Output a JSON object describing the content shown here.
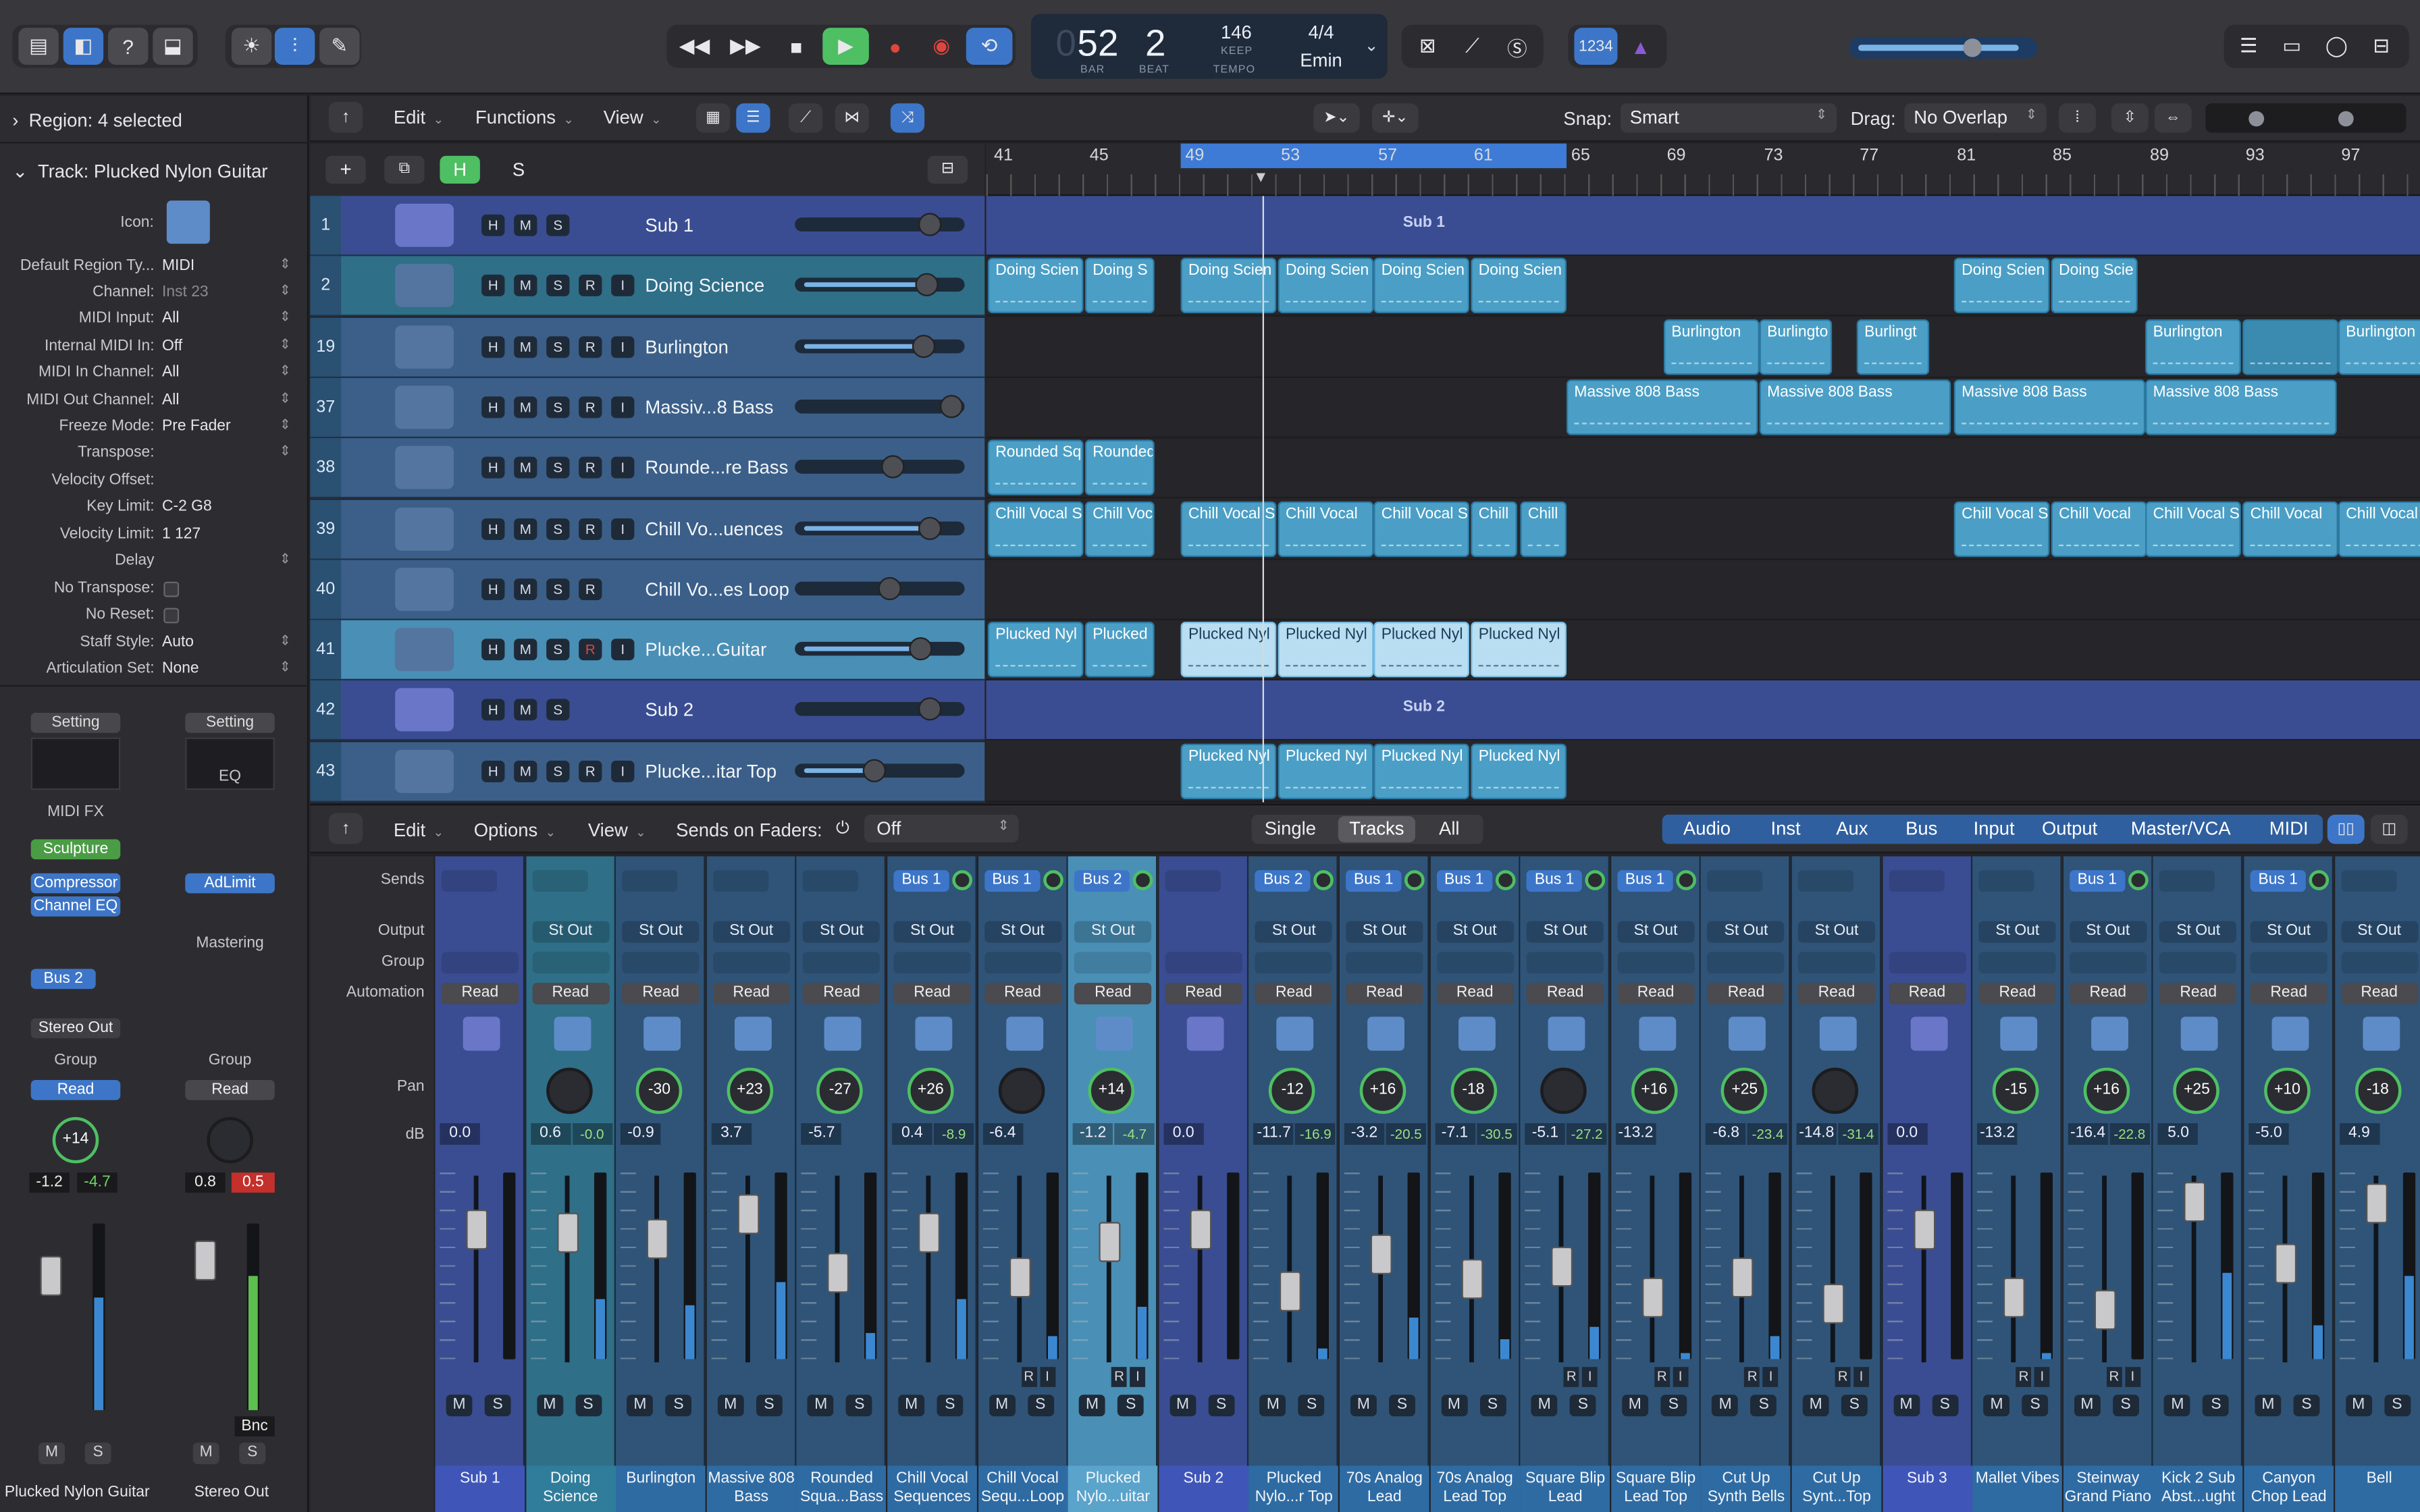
{
  "control_bar": {
    "lcd": {
      "bar": "52",
      "beat": "2",
      "bar_label": "BAR",
      "beat_label": "BEAT",
      "tempo": "146",
      "tempo_keep": "KEEP",
      "tempo_label": "TEMPO",
      "signature": "4/4",
      "key": "Emin"
    },
    "count_in": "1234",
    "icons": [
      "library-icon",
      "inspector-icon",
      "quick-help-icon",
      "toolbar-icon",
      "tuner-icon",
      "mixer-settings-icon",
      "pencil-icon",
      "rewind-icon",
      "fast-forward-icon",
      "stop-icon",
      "play-icon",
      "record-icon",
      "replace-icon",
      "cycle-icon",
      "lcd-menu-icon",
      "mute-icon",
      "tuning-icon",
      "solo-icon",
      "metronome-icon",
      "list-editors-icon",
      "note-pad-icon",
      "loop-browser-icon",
      "browsers-icon"
    ]
  },
  "inspector": {
    "region_header": "Region: 4 selected",
    "track_header": "Track: Plucked Nylon Guitar",
    "icon_label": "Icon:",
    "rows": [
      {
        "label": "Default Region Ty...",
        "value": "MIDI",
        "stepper": true
      },
      {
        "label": "Channel:",
        "value": "Inst 23",
        "stepper": true,
        "dim": true
      },
      {
        "label": "MIDI Input:",
        "value": "All",
        "stepper": true
      },
      {
        "label": "Internal MIDI In:",
        "value": "Off",
        "stepper": true
      },
      {
        "label": "MIDI In Channel:",
        "value": "All",
        "stepper": true
      },
      {
        "label": "MIDI Out Channel:",
        "value": "All",
        "stepper": true
      },
      {
        "label": "Freeze Mode:",
        "value": "Pre Fader",
        "stepper": true
      },
      {
        "label": "Transpose:",
        "value": "",
        "stepper": true
      },
      {
        "label": "Velocity Offset:",
        "value": "",
        "stepper": false
      },
      {
        "label": "Key Limit:",
        "value": "C-2  G8",
        "stepper": false
      },
      {
        "label": "Velocity Limit:",
        "value": "1  127",
        "stepper": false
      },
      {
        "label": "Delay",
        "value": "",
        "stepper": true
      },
      {
        "label": "No Transpose:",
        "value": "",
        "checkbox": true
      },
      {
        "label": "No Reset:",
        "value": "",
        "checkbox": true
      },
      {
        "label": "Staff Style:",
        "value": "Auto",
        "stepper": true
      },
      {
        "label": "Articulation Set:",
        "value": "None",
        "stepper": true
      }
    ],
    "strip_left": {
      "setting": "Setting",
      "midi_fx": "MIDI FX",
      "plugin1": "Sculpture",
      "plugin2": "Compressor",
      "plugin3": "Channel EQ",
      "send": "Bus 2",
      "output": "Stereo Out",
      "group": "Group",
      "automation": "Read",
      "pan": "+14",
      "db1": "-1.2",
      "db2": "-4.7",
      "mute": "M",
      "solo": "S",
      "name": "Plucked Nylon Guitar"
    },
    "strip_right": {
      "setting": "Setting",
      "eq": "EQ",
      "plugin1": "AdLimit",
      "mastering": "Mastering",
      "group": "Group",
      "automation": "Read",
      "db1": "0.8",
      "db2": "0.5",
      "bounce": "Bnc",
      "mute": "M",
      "solo": "S",
      "name": "Stereo Out"
    }
  },
  "tracks_toolbar": {
    "edit": "Edit",
    "functions": "Functions",
    "view": "View",
    "snap_label": "Snap:",
    "snap_value": "Smart",
    "drag_label": "Drag:",
    "drag_value": "No Overlap"
  },
  "track_header_buttons": {
    "add": "+",
    "h": "H",
    "s": "S"
  },
  "ruler": [
    "41",
    "45",
    "49",
    "53",
    "57",
    "61",
    "65",
    "69",
    "73",
    "77",
    "81",
    "85",
    "89",
    "93",
    "97"
  ],
  "tracks": [
    {
      "num": "1",
      "name": "Sub 1",
      "buttons": [
        "H",
        "M",
        "S"
      ],
      "type": "sub",
      "label": "Sub 1"
    },
    {
      "num": "2",
      "name": "Doing Science",
      "buttons": [
        "H",
        "M",
        "S",
        "R",
        "I"
      ],
      "type": "teal"
    },
    {
      "num": "19",
      "name": "Burlington",
      "buttons": [
        "H",
        "M",
        "S",
        "R",
        "I"
      ],
      "type": "blue"
    },
    {
      "num": "37",
      "name": "Massiv...8 Bass",
      "buttons": [
        "H",
        "M",
        "S",
        "R",
        "I"
      ],
      "type": "blue"
    },
    {
      "num": "38",
      "name": "Rounde...re Bass",
      "buttons": [
        "H",
        "M",
        "S",
        "R",
        "I"
      ],
      "type": "blue"
    },
    {
      "num": "39",
      "name": "Chill Vo...uences",
      "buttons": [
        "H",
        "M",
        "S",
        "R",
        "I"
      ],
      "type": "blue"
    },
    {
      "num": "40",
      "name": "Chill Vo...es Loop",
      "buttons": [
        "H",
        "M",
        "S",
        "R"
      ],
      "type": "blue"
    },
    {
      "num": "41",
      "name": "Plucke...Guitar",
      "buttons": [
        "H",
        "M",
        "S",
        "R",
        "I"
      ],
      "type": "sel"
    },
    {
      "num": "42",
      "name": "Sub 2",
      "buttons": [
        "H",
        "M",
        "S"
      ],
      "type": "sub",
      "label": "Sub 2"
    },
    {
      "num": "43",
      "name": "Plucke...itar Top",
      "buttons": [
        "H",
        "M",
        "S",
        "R",
        "I"
      ],
      "type": "blue"
    }
  ],
  "regions": {
    "doing": [
      "Doing Scien",
      "Doing S",
      "Doing Scien",
      "Doing Scien",
      "Doing Scien",
      "Doing Scien",
      "Doing Scien",
      "Doing Scie"
    ],
    "burlington": [
      "Burlington",
      "Burlingto",
      "Burlingt",
      "Burlington",
      "",
      "Burlington"
    ],
    "massive": [
      "Massive 808 Bass",
      "Massive 808 Bass",
      "Massive 808 Bass",
      "Massive 808 Bass"
    ],
    "rounded": [
      "Rounded Sq",
      "Rounded"
    ],
    "chill": [
      "Chill Vocal S",
      "Chill Voc",
      "Chill Vocal S",
      "Chill Vocal",
      "Chill Vocal S",
      "Chill",
      "Chill",
      "Chill Vocal S",
      "Chill Vocal",
      "Chill Vocal S",
      "Chill Vocal",
      "Chill Vocal"
    ],
    "plucked": [
      "Plucked Nyl",
      "Plucked",
      "Plucked Nyl",
      "Plucked Nyl",
      "Plucked Nyl",
      "Plucked Nyl"
    ],
    "plucked_top": [
      "Plucked Nyl",
      "Plucked Nyl",
      "Plucked Nyl",
      "Plucked Nyl"
    ]
  },
  "mixer_toolbar": {
    "edit": "Edit",
    "options": "Options",
    "view": "View",
    "sends_on_faders": "Sends on Faders:",
    "sends_value": "Off",
    "single": "Single",
    "tracks": "Tracks",
    "all": "All",
    "filters": [
      "Audio",
      "Inst",
      "Aux",
      "Bus",
      "Input",
      "Output",
      "Master/VCA",
      "MIDI"
    ]
  },
  "mixer_labels": {
    "sends": "Sends",
    "output": "Output",
    "group": "Group",
    "automation": "Automation",
    "pan": "Pan",
    "db": "dB"
  },
  "strips": [
    {
      "name": "Sub 1",
      "type": "sub",
      "send": "",
      "output": "",
      "pan": "",
      "db1": "0.0",
      "db2": "",
      "fader": 0.78
    },
    {
      "name": "Doing Science",
      "type": "teal",
      "send": "",
      "output": "St Out",
      "pan": "",
      "db1": "0.6",
      "db2": "-0.0",
      "fader": 0.76
    },
    {
      "name": "Burlington",
      "type": "blue",
      "send": "",
      "output": "St Out",
      "pan": "-30",
      "db1": "-0.9",
      "db2": "",
      "fader": 0.72
    },
    {
      "name": "Massive 808 Bass",
      "type": "blue",
      "send": "",
      "output": "St Out",
      "pan": "+23",
      "db1": "3.7",
      "db2": "",
      "fader": 0.88
    },
    {
      "name": "Rounded Squa...Bass",
      "type": "blue",
      "send": "",
      "output": "St Out",
      "pan": "-27",
      "db1": "-5.7",
      "db2": "",
      "fader": 0.5
    },
    {
      "name": "Chill Vocal Sequences",
      "type": "blue",
      "send": "Bus 1",
      "output": "St Out",
      "pan": "+26",
      "db1": "0.4",
      "db2": "-8.9",
      "fader": 0.76
    },
    {
      "name": "Chill Vocal Sequ...Loop",
      "type": "blue",
      "send": "Bus 1",
      "output": "St Out",
      "pan": "",
      "db1": "-6.4",
      "db2": "",
      "fader": 0.47
    },
    {
      "name": "Plucked Nylo...uitar",
      "type": "sel",
      "send": "Bus 2",
      "output": "St Out",
      "pan": "+14",
      "db1": "-1.2",
      "db2": "-4.7",
      "fader": 0.7
    },
    {
      "name": "Sub 2",
      "type": "sub",
      "send": "",
      "output": "",
      "pan": "",
      "db1": "0.0",
      "db2": "",
      "fader": 0.78
    },
    {
      "name": "Plucked Nylo...r Top",
      "type": "blue",
      "send": "Bus 2",
      "output": "St Out",
      "pan": "-12",
      "db1": "-11.7",
      "db2": "-16.9",
      "fader": 0.38
    },
    {
      "name": "70s Analog Lead",
      "type": "blue",
      "send": "Bus 1",
      "output": "St Out",
      "pan": "+16",
      "db1": "-3.2",
      "db2": "-20.5",
      "fader": 0.62
    },
    {
      "name": "70s Analog Lead Top",
      "type": "blue",
      "send": "Bus 1",
      "output": "St Out",
      "pan": "-18",
      "db1": "-7.1",
      "db2": "-30.5",
      "fader": 0.46
    },
    {
      "name": "Square Blip Lead",
      "type": "blue",
      "send": "Bus 1",
      "output": "St Out",
      "pan": "",
      "db1": "-5.1",
      "db2": "-27.2",
      "fader": 0.54
    },
    {
      "name": "Square Blip Lead Top",
      "type": "blue",
      "send": "Bus 1",
      "output": "St Out",
      "pan": "+16",
      "db1": "-13.2",
      "db2": "",
      "fader": 0.34
    },
    {
      "name": "Cut Up Synth Bells",
      "type": "blue",
      "send": "",
      "output": "St Out",
      "pan": "+25",
      "db1": "-6.8",
      "db2": "-23.4",
      "fader": 0.47
    },
    {
      "name": "Cut Up Synt...Top",
      "type": "blue",
      "send": "",
      "output": "St Out",
      "pan": "",
      "db1": "-14.8",
      "db2": "-31.4",
      "fader": 0.3
    },
    {
      "name": "Sub 3",
      "type": "sub",
      "send": "",
      "output": "",
      "pan": "",
      "db1": "0.0",
      "db2": "",
      "fader": 0.78
    },
    {
      "name": "Mallet Vibes",
      "type": "blue",
      "send": "",
      "output": "St Out",
      "pan": "-15",
      "db1": "-13.2",
      "db2": "",
      "fader": 0.34
    },
    {
      "name": "Steinway Grand Piano",
      "type": "blue",
      "send": "Bus 1",
      "output": "St Out",
      "pan": "+16",
      "db1": "-16.4",
      "db2": "-22.8",
      "fader": 0.26
    },
    {
      "name": "Kick 2 Sub Abst...ught",
      "type": "blue",
      "send": "",
      "output": "St Out",
      "pan": "+25",
      "db1": "5.0",
      "db2": "",
      "fader": 0.96
    },
    {
      "name": "Canyon Chop Lead",
      "type": "blue",
      "send": "Bus 1",
      "output": "St Out",
      "pan": "+10",
      "db1": "-5.0",
      "db2": "",
      "fader": 0.56
    },
    {
      "name": "Bell",
      "type": "blue",
      "send": "",
      "output": "St Out",
      "pan": "-18",
      "db1": "4.9",
      "db2": "",
      "fader": 0.95
    }
  ],
  "strip_common": {
    "read": "Read",
    "mute": "M",
    "solo": "S",
    "r": "R",
    "i": "I"
  }
}
